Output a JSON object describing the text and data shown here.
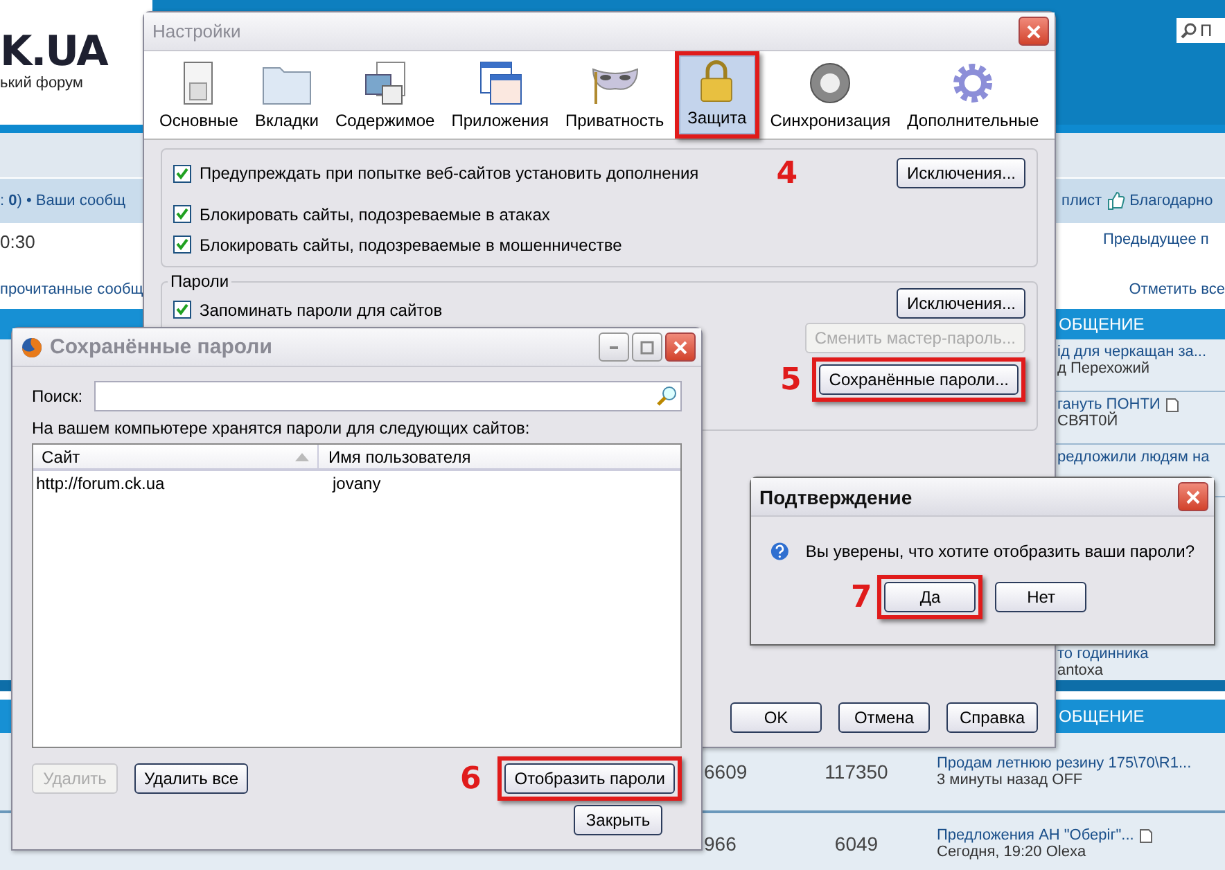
{
  "forum": {
    "logo": "K.UA",
    "tagline": "ький форум",
    "search_placeholder": "П",
    "stats_text": ": **0**) • Ваши сообщ",
    "nav_right": [
      "плист",
      "Благодарно"
    ],
    "time": "0:30",
    "prev_link": "Предыдущее п",
    "unread_link": "прочитанные сообщ",
    "mark_all": "Отметить все",
    "section_header": "ОБЩЕНИЕ",
    "topics": [
      {
        "title": "ід для черкащан за...",
        "sub": "д Перехожий"
      },
      {
        "title": "гануть ПОНТИ",
        "sub": "СВЯТ0Й"
      },
      {
        "title": "редложили людям на"
      },
      {
        "title": "то годинника",
        "sub": "antoxa"
      }
    ],
    "section_header_2": "ОБЩЕНИЕ",
    "rows": [
      {
        "replies": "6609",
        "views": "117350",
        "title": "Продам летнюю резину 175\\70\\R1...",
        "sub": "3 минуты назад OFF"
      },
      {
        "replies": "966",
        "views": "6049",
        "title": "Предложения АН \"Оберіг\"...",
        "sub": "Сегодня, 19:20 Olexa"
      }
    ]
  },
  "settings": {
    "title": "Настройки",
    "tabs": [
      {
        "label": "Основные",
        "kind": "switch",
        "selected": false,
        "highlighted": false
      },
      {
        "label": "Вкладки",
        "kind": "folder",
        "selected": false,
        "highlighted": false
      },
      {
        "label": "Содержимое",
        "kind": "content",
        "selected": false,
        "highlighted": false
      },
      {
        "label": "Приложения",
        "kind": "apps",
        "selected": false,
        "highlighted": false
      },
      {
        "label": "Приватность",
        "kind": "mask",
        "selected": false,
        "highlighted": false
      },
      {
        "label": "Защита",
        "kind": "lock",
        "selected": true,
        "highlighted": true
      },
      {
        "label": "Синхронизация",
        "kind": "sync",
        "selected": false,
        "highlighted": false
      },
      {
        "label": "Дополнительные",
        "kind": "gear",
        "selected": false,
        "highlighted": false
      }
    ],
    "callout": "4",
    "security": [
      {
        "label": "Предупреждать при попытке веб-сайтов установить дополнения",
        "checked": true,
        "button": "Исключения..."
      },
      {
        "label": "Блокировать сайты, подозреваемые в атаках",
        "checked": true
      },
      {
        "label": "Блокировать сайты, подозреваемые в мошенничестве",
        "checked": true
      }
    ],
    "passwords": {
      "legend": "Пароли",
      "remember": {
        "label": "Запоминать пароли для сайтов",
        "checked": true
      },
      "buttons": [
        {
          "label": "Исключения...",
          "disabled": false,
          "highlighted": false
        },
        {
          "label": "Сменить мастер-пароль...",
          "disabled": true,
          "highlighted": false
        },
        {
          "label": "Сохранённые пароли...",
          "disabled": false,
          "highlighted": true,
          "callout": "5"
        }
      ]
    },
    "footer": [
      "OK",
      "Отмена",
      "Справка"
    ]
  },
  "saved": {
    "title": "Сохранённые пароли",
    "search_label": "Поиск:",
    "info": "На вашем компьютере хранятся пароли для следующих сайтов:",
    "columns": [
      "Сайт",
      "Имя пользователя"
    ],
    "rows": [
      {
        "site": "http://forum.ck.ua",
        "user": "jovany"
      }
    ],
    "buttons": [
      {
        "label": "Удалить",
        "disabled": true
      },
      {
        "label": "Удалить все",
        "disabled": false
      }
    ],
    "show": {
      "label": "Отобразить пароли",
      "highlighted": true,
      "callout": "6"
    },
    "close": "Закрыть"
  },
  "confirm": {
    "title": "Подтверждение",
    "message": "Вы уверены, что хотите отобразить ваши пароли?",
    "buttons": [
      {
        "label": "Да",
        "highlighted": true,
        "callout": "7"
      },
      {
        "label": "Нет",
        "highlighted": false
      }
    ]
  }
}
